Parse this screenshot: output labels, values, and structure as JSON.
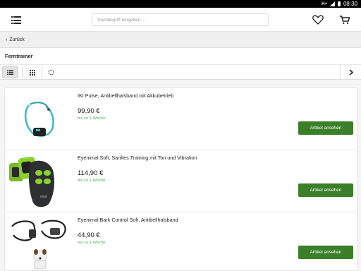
{
  "statusbar": {
    "network": "H+",
    "time": "08:30"
  },
  "header": {
    "menu_icon": "hamburger-menu-icon",
    "search_placeholder": "Suchbegriff eingeben ...",
    "wishlist_icon": "heart-icon",
    "cart_icon": "shopping-cart-icon"
  },
  "back": {
    "label": "Zurück"
  },
  "category": {
    "title": "Ferntrainer"
  },
  "viewbar": {
    "views": [
      "list-view-icon",
      "grid-view-icon",
      "filter-icon"
    ],
    "next_icon": "chevron-right-icon"
  },
  "products": [
    {
      "name": "IKI Pulse, Antibellhalsband mit Akkubetrieb",
      "price": "99,90 €",
      "availability": "bis zu 1 Woche",
      "button": "Artikel ansehen"
    },
    {
      "name": "Eyenimal Soft, Sanftes Training mit Ton und Vibration",
      "price": "114,90 €",
      "availability": "bis zu 1 Woche",
      "button": "Artikel ansehen"
    },
    {
      "name": "Eyenimal Bark Control Soft, Antibellhalsband",
      "price": "44,90 €",
      "availability": "bis zu 1 Woche",
      "button": "Artikel ansehen"
    }
  ],
  "colors": {
    "accent": "#3b7f2a",
    "availability": "#4caa5d"
  }
}
